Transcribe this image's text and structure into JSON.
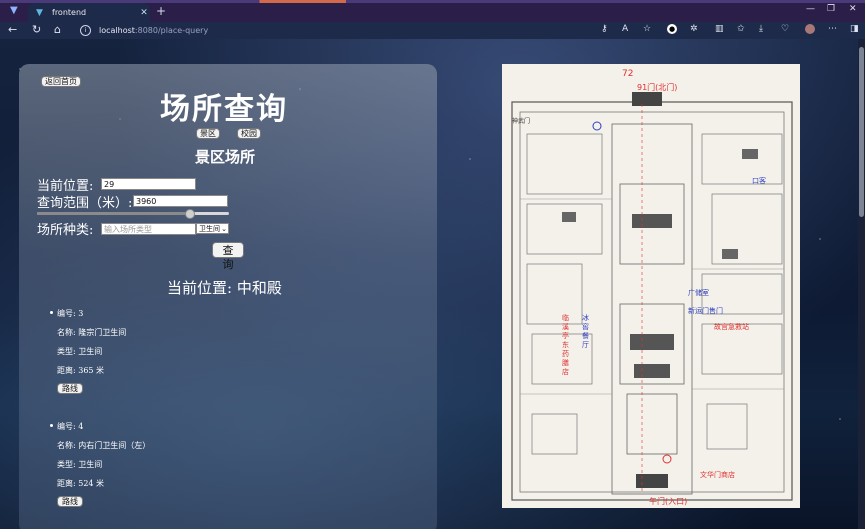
{
  "browser": {
    "tab_title": "frontend",
    "url_host": "localhost",
    "url_path": ":8080/place-query"
  },
  "page": {
    "back_button": "返回首页",
    "title": "场所查询",
    "mode_buttons": [
      "景区",
      "校园"
    ],
    "subtitle": "景区场所",
    "position_label": "当前位置:",
    "position_value": "29",
    "range_label": "查询范围（米）:",
    "range_value": "3960",
    "range_slider_fraction": 0.79,
    "type_label": "场所种类:",
    "type_placeholder": "输入场所类型",
    "type_select_value": "卫生间",
    "query_button": "查询",
    "current_location_text": "当前位置: 中和殿",
    "results": [
      {
        "number": "编号: 3",
        "name": "名称: 隆宗门卫生间",
        "type": "类型: 卫生间",
        "distance": "距离: 365 米",
        "route": "路线"
      },
      {
        "number": "编号: 4",
        "name": "名称: 内右门卫生间（左）",
        "type": "类型: 卫生间",
        "distance": "距离: 524 米",
        "route": "路线"
      }
    ]
  },
  "map": {
    "top_label": "91门(北门)",
    "labels": [
      {
        "text": "72",
        "color": "#e03030"
      },
      {
        "text": "神武门",
        "color": "#333333"
      },
      {
        "text": "东华门",
        "color": "#333333"
      },
      {
        "text": "广储室",
        "color": "#3040c0"
      },
      {
        "text": "新运门售门",
        "color": "#3040c0"
      },
      {
        "text": "临溪亭东药膳店",
        "color": "#e03030"
      },
      {
        "text": "冰窖餐厅",
        "color": "#3040c0"
      },
      {
        "text": "故宫急救站",
        "color": "#e03030"
      },
      {
        "text": "文华门商店",
        "color": "#e03030"
      },
      {
        "text": "午门(入口)",
        "color": "#e03030"
      },
      {
        "text": "口客",
        "color": "#3040c0"
      }
    ]
  }
}
